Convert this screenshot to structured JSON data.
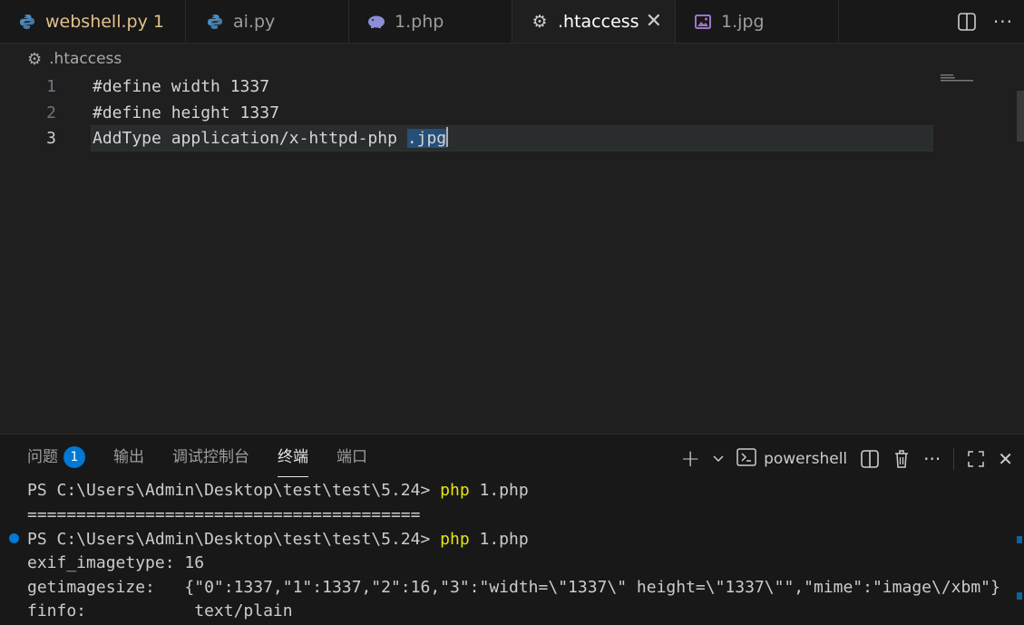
{
  "tabs": [
    {
      "label": "webshell.py",
      "badge": "1",
      "icon": "python-icon",
      "color": "#e2c08d"
    },
    {
      "label": "ai.py",
      "icon": "python-icon"
    },
    {
      "label": "1.php",
      "icon": "php-elephant-icon"
    },
    {
      "label": ".htaccess",
      "icon": "gear-icon",
      "active": true
    },
    {
      "label": "1.jpg",
      "icon": "image-icon"
    }
  ],
  "tab_actions": [
    "split-editor-icon",
    "more-actions-icon"
  ],
  "breadcrumb": {
    "file": ".htaccess",
    "icon": "gear-icon"
  },
  "editor": {
    "lines": [
      {
        "number": "1",
        "text": "#define width 1337"
      },
      {
        "number": "2",
        "text": "#define height 1337"
      },
      {
        "number": "3",
        "text_before": "AddType application/x-httpd-php ",
        "text_selected": ".jpg"
      }
    ]
  },
  "panel": {
    "tabs": [
      {
        "label": "问题",
        "badge": "1"
      },
      {
        "label": "输出"
      },
      {
        "label": "调试控制台"
      },
      {
        "label": "终端",
        "active": true
      },
      {
        "label": "端口"
      }
    ],
    "shell": "powershell",
    "actions": [
      "add-terminal-icon",
      "chevron-down-icon",
      "terminal-icon",
      "split-terminal-icon",
      "trash-icon",
      "more-actions-icon",
      "maximize-icon",
      "close-icon"
    ]
  },
  "terminal": {
    "lines": [
      {
        "prompt": "PS C:\\Users\\Admin\\Desktop\\test\\test\\5.24> ",
        "cmd_name": "php",
        "cmd_args": " 1.php"
      },
      {
        "text": "========================================"
      },
      {
        "prompt": "PS C:\\Users\\Admin\\Desktop\\test\\test\\5.24> ",
        "cmd_name": "php",
        "cmd_args": " 1.php",
        "marker": true
      },
      {
        "text": "exif_imagetype: 16"
      },
      {
        "text": "getimagesize:   {\"0\":1337,\"1\":1337,\"2\":16,\"3\":\"width=\\\"1337\\\" height=\\\"1337\\\"\",\"mime\":\"image\\/xbm\"}"
      },
      {
        "text": "finfo:           text/plain"
      }
    ]
  },
  "colors": {
    "accent": "#0078d4",
    "command": "#e5e510",
    "modified_tab": "#e2c08d",
    "selection": "#264f78"
  }
}
